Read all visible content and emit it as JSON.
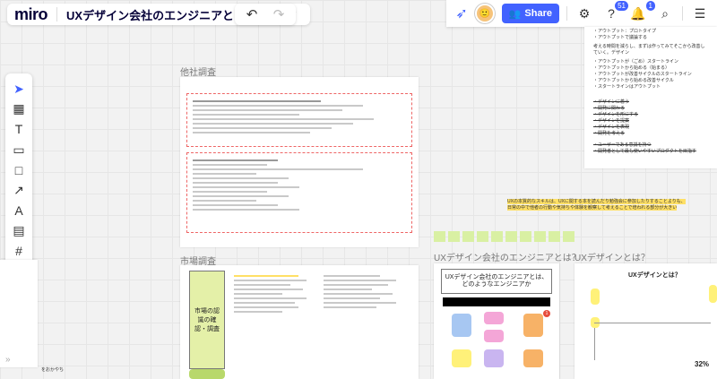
{
  "app": {
    "logo": "miro",
    "board_title": "UXデザイン会社のエンジニアとは",
    "star_icon": "☆",
    "export_icon": "⇪",
    "undo_icon": "↶",
    "redo_icon": "↷"
  },
  "header_right": {
    "share_label": "Share",
    "share_icon": "👥",
    "settings_icon": "⚙",
    "help_icon": "?",
    "help_badge": "51",
    "notif_icon": "🔔",
    "notif_badge": "1",
    "search_icon": "⌕",
    "board_menu_icon": "☰"
  },
  "tools": [
    "➤",
    "▦",
    "T",
    "▭",
    "□",
    "↗",
    "A",
    "▤",
    "#",
    "⊕",
    "⋯"
  ],
  "frames": {
    "research_label": "他社調査",
    "market_label": "市場調査",
    "ux_engineer_label": "UXデザイン会社のエンジニアとは？",
    "ux_design_label": "UXデザインとは？",
    "ux_engineer_card_title": "UXデザイン会社のエンジニアとは、\nどのようなエンジニアか",
    "ux_design_card_title": "UXデザインとは？",
    "market_box": "市場の認識の確認・調査",
    "percent": "32%"
  },
  "callout": {
    "line1": "UXの本質的なスキルは、UXに関する本を読んだり勉強会に参加したりすることよりも、",
    "line2": "日常の中で他者の行動や気持ちや体験を観察して考えることで培われる部分が大きい"
  },
  "right_panel": [
    "・アウトプット：プロトタイプ",
    "・アウトプットで議論する",
    "考える時間を減らし、まずは作ってみてそこから改善していく。デザイン",
    "・アウトプットが（ごめ）スタートライン",
    "・アウトプットから始める（始まる）",
    "・アウトプットが改善サイクルのスタートライン",
    "・アウトプットから始める改善サイクル",
    "・スタートラインはアウトプット",
    "・デザインに着う",
    "・開発に関わる",
    "・デザインを形にする",
    "・デザインを提案",
    "・デザインを表現",
    "・開発を考える",
    "・ユーザーである意識を持つ",
    "・開発者として最も使いやすいプロダクトを目指す"
  ],
  "bottom_left_text": "をおかやち"
}
